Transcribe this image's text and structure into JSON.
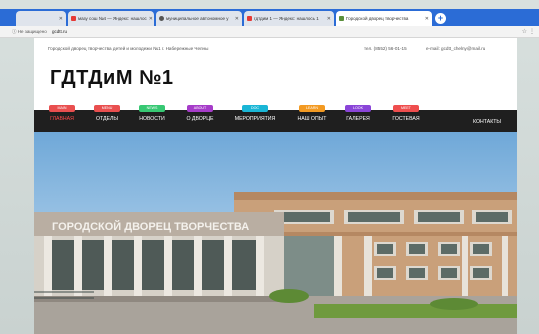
{
  "browser": {
    "tabs": [
      {
        "label": "",
        "active": false
      },
      {
        "label": "мазу сош №4 — Яндекс: нашлос",
        "active": false
      },
      {
        "label": "муниципальное автономное у",
        "active": false
      },
      {
        "label": "гдтдим 1 — Яндекс: нашлось 1",
        "active": false
      },
      {
        "label": "Городской дворец творчества",
        "active": true
      }
    ],
    "address": {
      "security": "Не защищено",
      "url": "gcdtt.ru"
    }
  },
  "site": {
    "top_text": "Городской дворец творчества детей и молодежи №1 г. Набережные Челны",
    "phone": "тел. (8552) 56-01-15",
    "email": "e-mail: gcdtt_chelny@mail.ru",
    "logo": "ГДТДиМ №1",
    "nav": [
      {
        "tag": "MAIN",
        "label": "ГЛАВНАЯ",
        "color": "#e94f4f",
        "active": true
      },
      {
        "tag": "MENU",
        "label": "ОТДЕЛЫ",
        "color": "#e94f4f",
        "active": false
      },
      {
        "tag": "NEWS",
        "label": "НОВОСТИ",
        "color": "#37c873",
        "active": false
      },
      {
        "tag": "ABOUT",
        "label": "О ДВОРЦЕ",
        "color": "#a63cc9",
        "active": false
      },
      {
        "tag": "DOC",
        "label": "МЕРОПРИЯТИЯ",
        "color": "#1ab6d6",
        "active": false
      },
      {
        "tag": "LEARN",
        "label": "НАШ ОПЫТ",
        "color": "#f39a22",
        "active": false
      },
      {
        "tag": "LOOK",
        "label": "ГАЛЕРЕЯ",
        "color": "#8a45d8",
        "active": false
      },
      {
        "tag": "MEET",
        "label": "ГОСТЕВАЯ",
        "color": "#ef4e4e",
        "active": false
      }
    ],
    "contacts": "КОНТАКТЫ",
    "hero_sign": "ГОРОДСКОЙ ДВОРЕЦ ТВОРЧЕСТВА"
  }
}
